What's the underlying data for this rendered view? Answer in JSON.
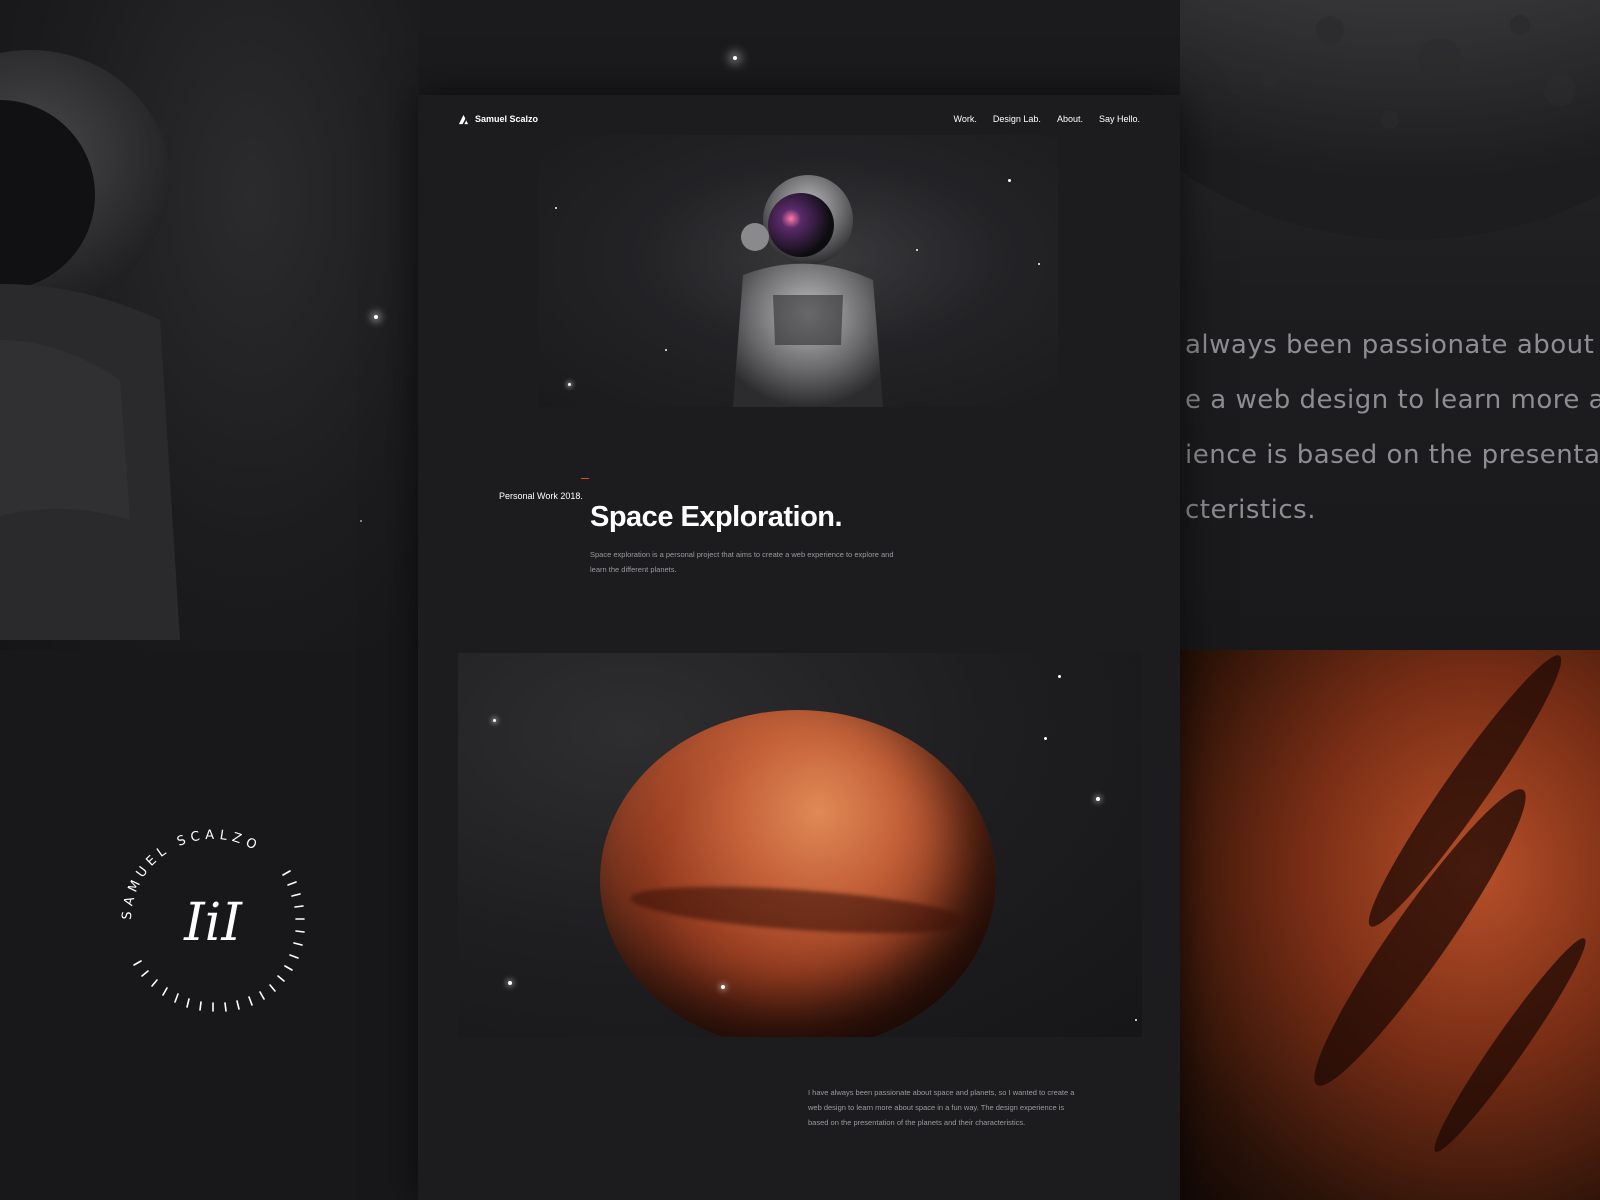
{
  "nav": {
    "brand": "Samuel Scalzo",
    "items": [
      "Work.",
      "Design Lab.",
      "About.",
      "Say Hello."
    ]
  },
  "intro": {
    "eyebrow": "Personal Work 2018.",
    "title": "Space Exploration.",
    "description": "Space exploration is a personal project that aims to create a web experience to explore and learn the different planets."
  },
  "story": {
    "text": "I have always been passionate about space and planets, so I wanted to create a web design to learn more about space in a fun way. The design experience is based on the presentation of the planets and their characteristics."
  },
  "background_quote": {
    "lines": [
      "always been passionate about",
      "e a web design to learn more ab",
      "ience is based on the presentat",
      "cteristics."
    ]
  },
  "badge": {
    "arc_text": "SAMUEL SCALZO",
    "monogram": "IiI"
  },
  "colors": {
    "background": "#151517",
    "page": "#1c1c1e",
    "accent": "#e04a2a",
    "mars": "#c5623a"
  }
}
